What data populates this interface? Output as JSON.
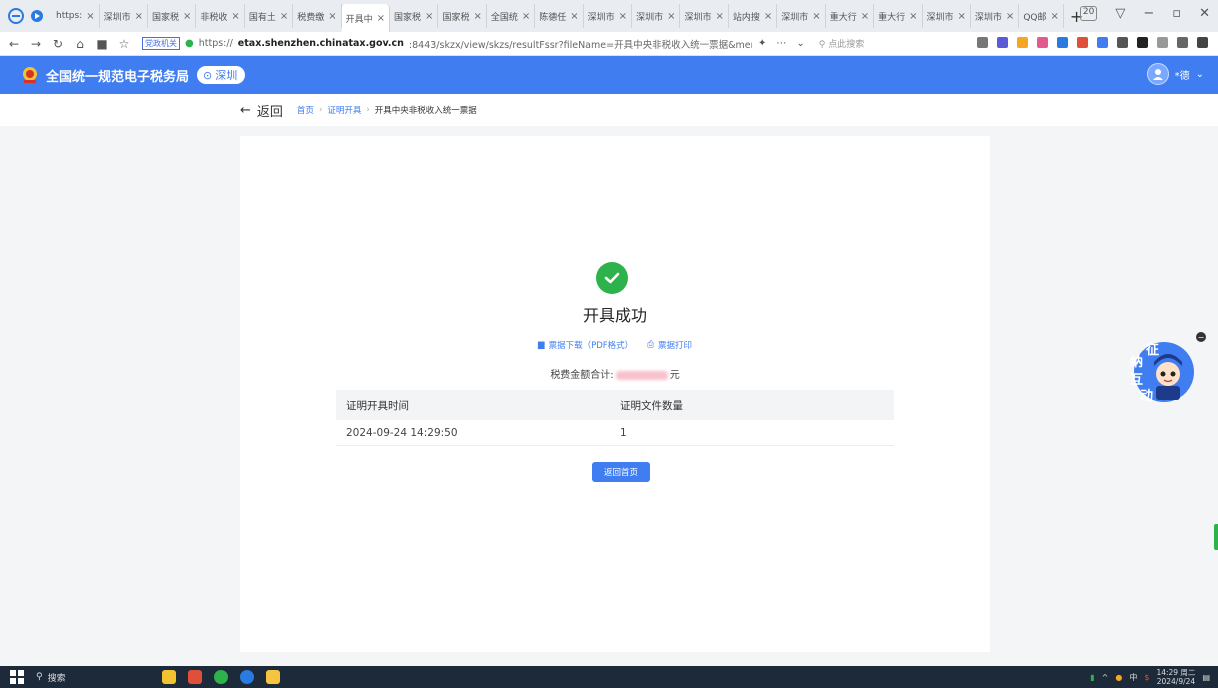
{
  "browser": {
    "tabs": [
      {
        "label": "https:"
      },
      {
        "label": "深圳市"
      },
      {
        "label": "国家税"
      },
      {
        "label": "非税收"
      },
      {
        "label": "国有土"
      },
      {
        "label": "税费缴"
      },
      {
        "label": "开具中",
        "active": true
      },
      {
        "label": "国家税"
      },
      {
        "label": "国家税"
      },
      {
        "label": "全国统"
      },
      {
        "label": "陈德任"
      },
      {
        "label": "深圳市"
      },
      {
        "label": "深圳市"
      },
      {
        "label": "深圳市"
      },
      {
        "label": "站内搜"
      },
      {
        "label": "深圳市"
      },
      {
        "label": "重大行"
      },
      {
        "label": "重大行"
      },
      {
        "label": "深圳市"
      },
      {
        "label": "深圳市"
      },
      {
        "label": "QQ邮"
      }
    ],
    "tab_close": "×",
    "new_tab": "+",
    "tab_count_badge": "20",
    "gov_badge": "党政机关",
    "url_scheme": "https://",
    "url_domain": "etax.shenzhen.chinatax.gov.cn",
    "url_rest": ":8443/skzx/view/skzs/resultFssr?fileName=开具中央非税收入统一票据&menutitle",
    "search_placeholder": "点此搜索"
  },
  "header": {
    "title": "全国统一规范电子税务局",
    "city": "深圳",
    "user_name": "*德"
  },
  "breadcrumb": {
    "back_label": "返回",
    "items": [
      "首页",
      "证明开具"
    ],
    "current": "开具中央非税收入统一票据"
  },
  "result": {
    "title": "开具成功",
    "download_label": "票据下载（PDF格式）",
    "print_label": "票据打印",
    "amount_label": "税费金额合计:",
    "amount_unit": "元",
    "table": {
      "headers": [
        "证明开具时间",
        "证明文件数量"
      ],
      "rows": [
        [
          "2024-09-24 14:29:50",
          "1"
        ]
      ]
    },
    "home_button": "返回首页"
  },
  "widget": {
    "chars": [
      "征",
      "纳",
      "互",
      "动"
    ]
  },
  "taskbar": {
    "search_label": "搜索",
    "time": "14:29 周二",
    "date": "2024/9/24",
    "ime": "中"
  },
  "colors": {
    "primary": "#3f7df0",
    "success": "#2db24c"
  }
}
